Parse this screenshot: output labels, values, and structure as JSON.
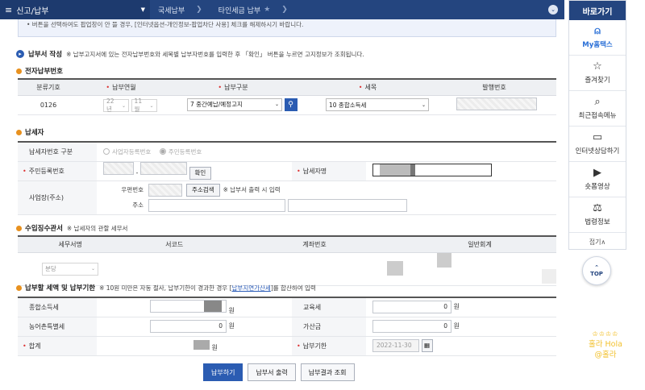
{
  "topnav": {
    "menu_title": "신고/납부",
    "crumbs": [
      "국세납부",
      "타인세금 납부"
    ]
  },
  "sidebar": {
    "title": "바로가기",
    "items": [
      {
        "label": "My홈택스",
        "icon": "person-icon"
      },
      {
        "label": "즐겨찾기",
        "icon": "star-icon"
      },
      {
        "label": "최근접속메뉴",
        "icon": "recent-search-icon"
      },
      {
        "label": "인터넷상담하기",
        "icon": "monitor-chat-icon"
      },
      {
        "label": "숏폼영상",
        "icon": "play-icon"
      },
      {
        "label": "법령정보",
        "icon": "gavel-icon"
      }
    ],
    "fold_label": "접기∧",
    "top_label": "TOP"
  },
  "notice": "• 버튼을 선택하여도 팝업창이 안 뜰 경우, [인터넷옵션-개인정보-팝업차단 사용] 체크를 해제하시기 바랍니다.",
  "form": {
    "section_title": "납부서 작성",
    "section_desc": "※ 납부고지서에 있는 전자납부번호와 세목별 납부자번호를 입력한 후 「확인」 버튼을 누르면 고지정보가 조회됩니다.",
    "elec_no": {
      "title": "전자납부번호",
      "headers": [
        "분류기호",
        "납부연월",
        "납부구분",
        "세목",
        "발행번호"
      ],
      "class_code": "0126",
      "year": "22년",
      "month": "11월",
      "pay_type": "7 중간예납/예정고지",
      "tax_item": "10 종합소득세"
    },
    "payer": {
      "title": "납세자",
      "id_type_label": "납세자번호 구분",
      "radio_biz": "사업자등록번호",
      "radio_resident": "주민등록번호",
      "resident_label": "주민등록번호",
      "confirm_btn": "확인",
      "name_label": "납세자명",
      "address_label": "사업장(주소)",
      "postcode_label": "우편번호",
      "addr_search_btn": "주소검색",
      "addr_note": "※ 납부서 출력 시 입력",
      "addr_label": "주소"
    },
    "receiver": {
      "title": "수입징수관서",
      "desc": "※ 납세자의 관할 세무서",
      "headers": [
        "세무서명",
        "서코드",
        "계좌번호",
        "일반회계"
      ],
      "office_select": "분당"
    },
    "amount": {
      "title": "납부할 세액 및 납부기한",
      "desc_prefix": "※ 10원 미만은 자동 절사, 납부기한이 경과한 경우 [",
      "desc_link": "납부지연가산세",
      "desc_suffix": "]를 합산하여 입력",
      "income_tax_label": "종합소득세",
      "edu_tax_label": "교육세",
      "edu_tax_value": "0",
      "rural_tax_label": "농어촌특별세",
      "rural_tax_value": "0",
      "penalty_label": "가산금",
      "penalty_value": "0",
      "total_label": "합계",
      "due_label": "납부기한",
      "due_value": "2022-11-30",
      "unit": "원"
    }
  },
  "buttons": {
    "pay": "납부하기",
    "print": "납부서 출력",
    "result": "납부결과 조회"
  },
  "watermark": {
    "crown": "♔♔♔♔",
    "line1": "홀라 Hola",
    "line2": "@홀라"
  }
}
